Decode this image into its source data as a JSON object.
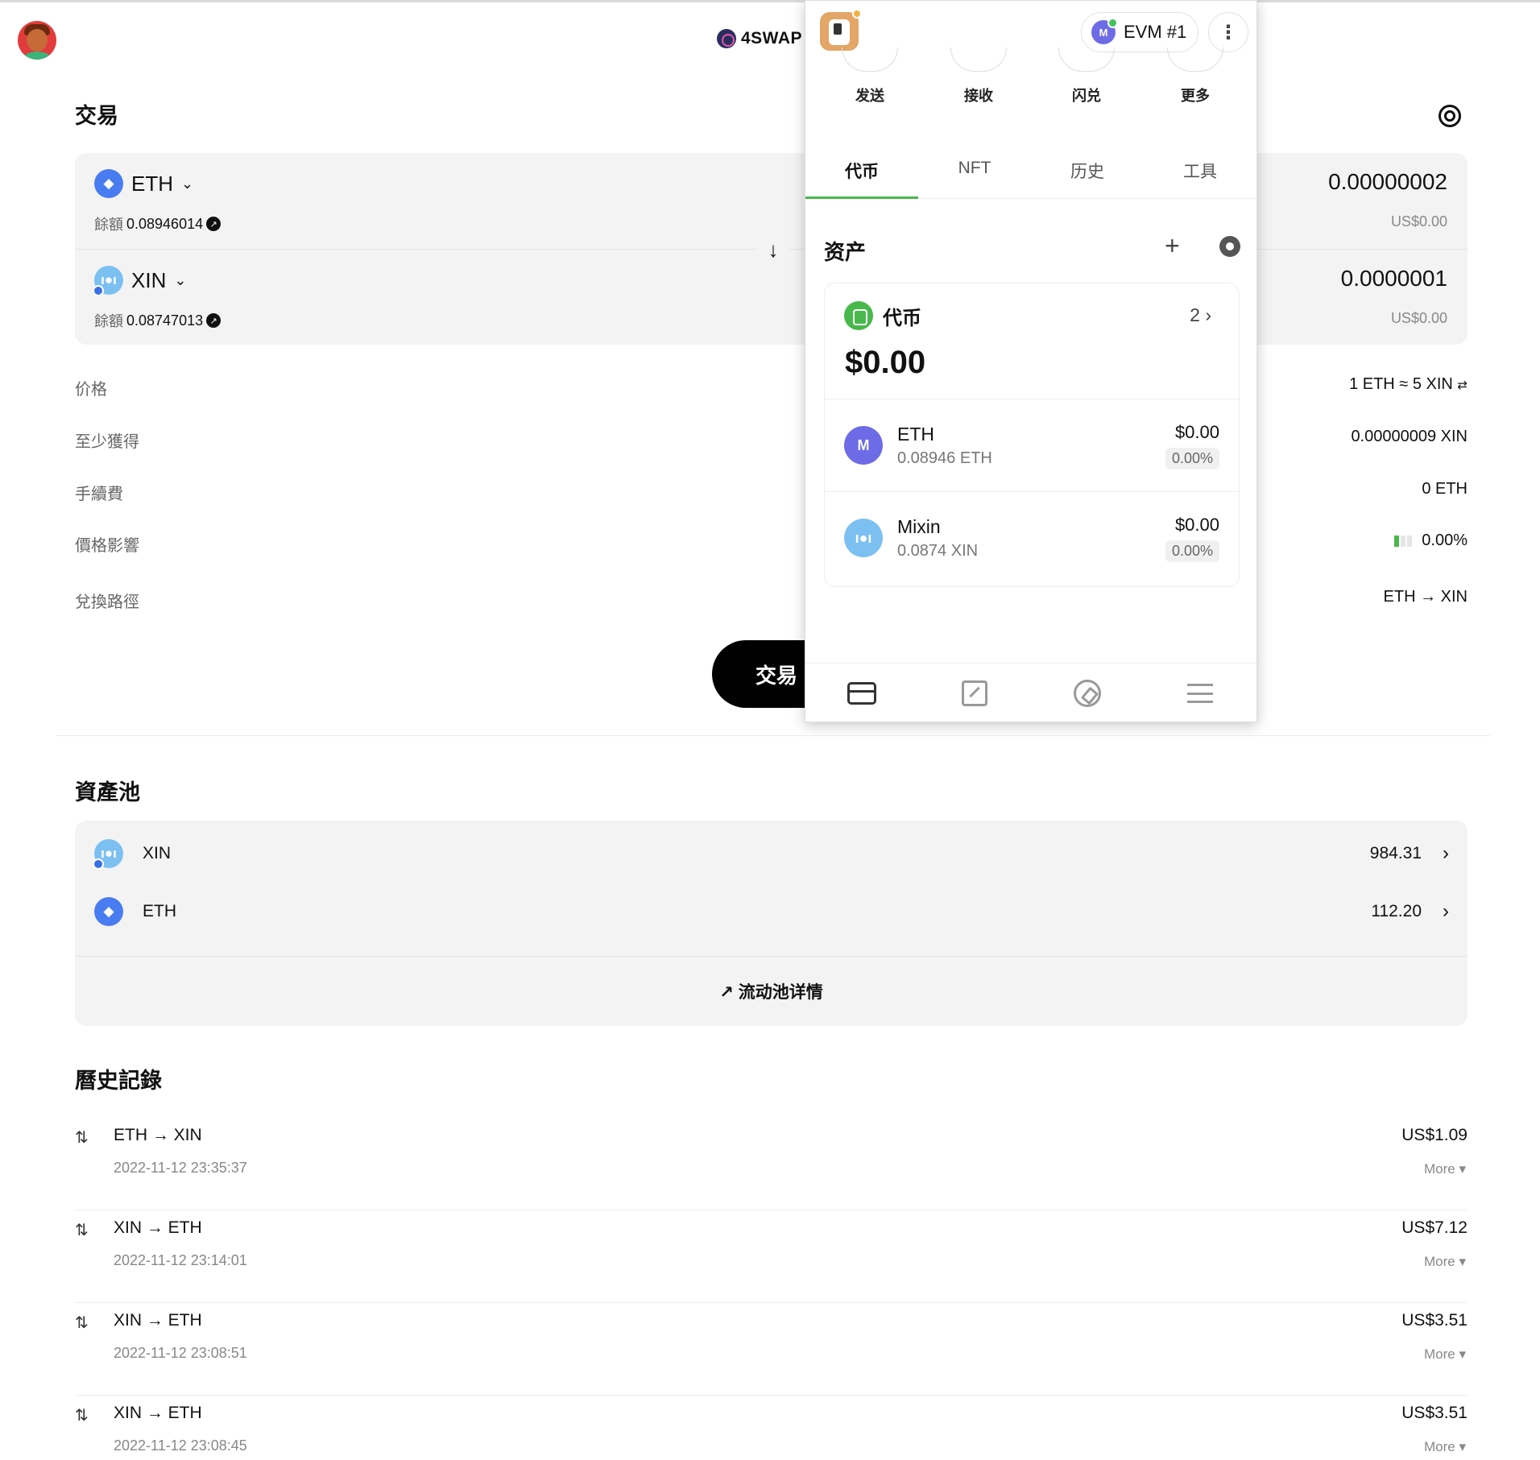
{
  "header": {
    "brand": "4SWAP"
  },
  "swap": {
    "section_title": "交易",
    "from": {
      "symbol": "ETH",
      "balance_label": "餘額",
      "balance": "0.08946014",
      "amount": "0.00000002",
      "usd": "US$0.00"
    },
    "to": {
      "symbol": "XIN",
      "balance_label": "餘額",
      "balance": "0.08747013",
      "amount": "0.0000001",
      "usd": "US$0.00"
    },
    "info": [
      {
        "label": "价格",
        "value": "1 ETH ≈ 5 XIN"
      },
      {
        "label": "至少獲得",
        "value": "0.00000009 XIN"
      },
      {
        "label": "手續費",
        "value": "0 ETH"
      },
      {
        "label": "價格影響",
        "value": "0.00%"
      },
      {
        "label": "兌換路徑",
        "value": "ETH → XIN"
      }
    ],
    "button": "交易"
  },
  "pool": {
    "section_title": "資產池",
    "rows": [
      {
        "symbol": "XIN",
        "value": "984.31"
      },
      {
        "symbol": "ETH",
        "value": "112.20"
      }
    ],
    "detail_link": "流动池详情"
  },
  "history": {
    "section_title": "曆史記錄",
    "items": [
      {
        "pair": "ETH → XIN",
        "time": "2022-11-12 23:35:37",
        "usd": "US$1.09",
        "more": "More"
      },
      {
        "pair": "XIN → ETH",
        "time": "2022-11-12 23:14:01",
        "usd": "US$7.12",
        "more": "More"
      },
      {
        "pair": "XIN → ETH",
        "time": "2022-11-12 23:08:51",
        "usd": "US$3.51",
        "more": "More"
      },
      {
        "pair": "XIN → ETH",
        "time": "2022-11-12 23:08:45",
        "usd": "US$3.51",
        "more": "More"
      }
    ]
  },
  "wallet": {
    "account": "EVM #1",
    "actions": [
      "发送",
      "接收",
      "闪兑",
      "更多"
    ],
    "tabs": [
      "代币",
      "NFT",
      "历史",
      "工具"
    ],
    "active_tab": "代币",
    "assets_title": "资产",
    "summary": {
      "label": "代币",
      "count": "2",
      "total": "$0.00"
    },
    "assets": [
      {
        "name": "ETH",
        "amount": "0.08946 ETH",
        "price": "$0.00",
        "change": "0.00%",
        "icon_color": "#6e6be6"
      },
      {
        "name": "Mixin",
        "amount": "0.0874 XIN",
        "price": "$0.00",
        "change": "0.00%",
        "icon_color": "#7cc0f2"
      }
    ]
  },
  "colors": {
    "accent_green": "#49b84c",
    "eth_blue": "#4a7cf1",
    "xin_blue": "#7cc0f2",
    "button_black": "#000000"
  }
}
